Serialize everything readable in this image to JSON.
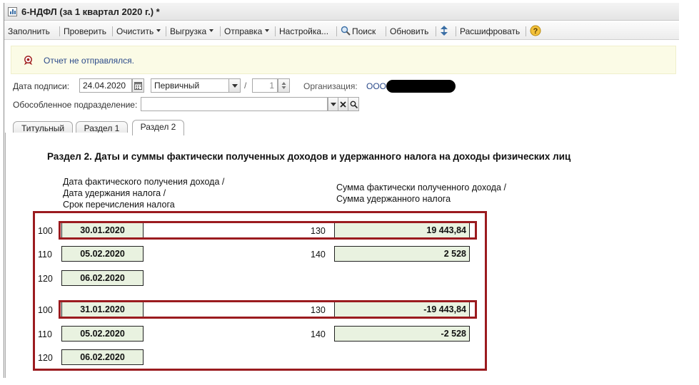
{
  "window": {
    "title": "6-НДФЛ (за 1 квартал 2020 г.) *"
  },
  "toolbar": {
    "items": [
      {
        "label": "Заполнить"
      },
      {
        "label": "Проверить"
      },
      {
        "label": "Очистить"
      },
      {
        "label": "Выгрузка"
      },
      {
        "label": "Отправка"
      },
      {
        "label": "Настройка..."
      },
      {
        "label": "Поиск",
        "icon": "magnifier-icon"
      },
      {
        "label": "Обновить"
      },
      {
        "label": "Расшифровать"
      }
    ],
    "help_icon": "question-icon"
  },
  "info": {
    "text": "Отчет не отправлялся.",
    "icon": "stamp-icon"
  },
  "form": {
    "sign_date_label": "Дата подписи:",
    "sign_date_value": "24.04.2020",
    "report_kind": "Первичный",
    "slash": "/",
    "correction_number": "1",
    "organization_label": "Организация:",
    "organization_value": "ООО",
    "branch_label": "Обособленное подразделение:",
    "branch_value": ""
  },
  "tabs": [
    {
      "label": "Титульный"
    },
    {
      "label": "Раздел 1"
    },
    {
      "label": "Раздел 2",
      "active": true
    }
  ],
  "section": {
    "heading": "Раздел 2.  Даты и суммы фактически полученных доходов и удержанного налога на доходы физических лиц",
    "col_left": [
      "Дата фактического получения дохода /",
      "Дата удержания налога /",
      "Срок перечисления налога"
    ],
    "col_right": [
      "Сумма фактически полученного дохода /",
      "Сумма удержанного налога"
    ],
    "blocks": [
      {
        "code_100": "100",
        "date_100": "30.01.2020",
        "code_130": "130",
        "sum_130": "19 443,84",
        "code_110": "110",
        "date_110": "05.02.2020",
        "code_140": "140",
        "sum_140": "2 528",
        "code_120": "120",
        "date_120": "06.02.2020"
      },
      {
        "code_100": "100",
        "date_100": "31.01.2020",
        "code_130": "130",
        "sum_130": "-19 443,84",
        "code_110": "110",
        "date_110": "05.02.2020",
        "code_140": "140",
        "sum_140": "-2 528",
        "code_120": "120",
        "date_120": "06.02.2020"
      }
    ]
  },
  "colors": {
    "highlight": "#9b1b1f",
    "cell_fill": "#e9f2e0",
    "info_text": "#2b4a8a",
    "info_bg": "#fbfbe6"
  }
}
